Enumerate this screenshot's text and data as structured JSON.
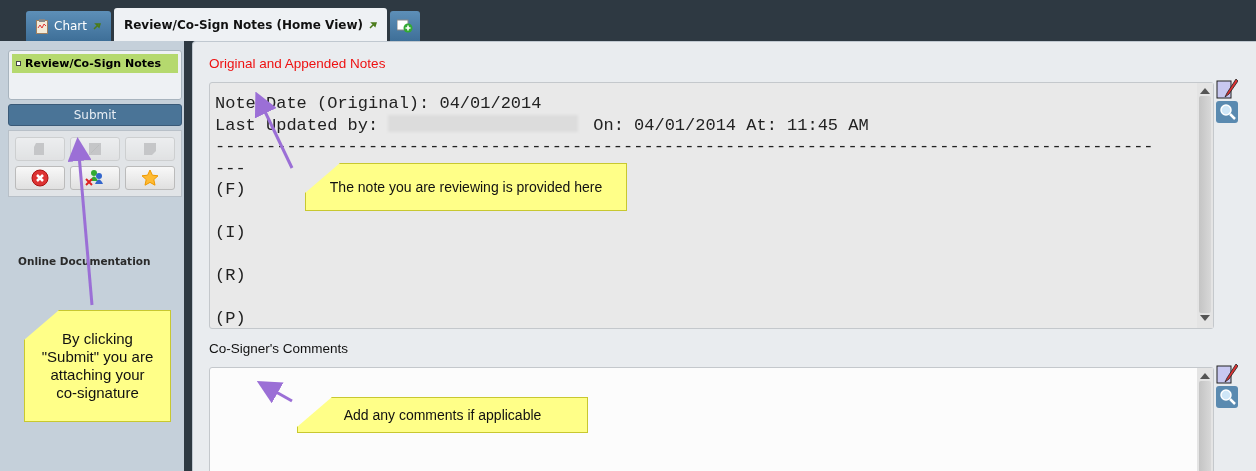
{
  "tabs": [
    {
      "label": "Chart",
      "kind": "chart",
      "selected": false
    },
    {
      "label": "Review/Co-Sign Notes (Home View)",
      "kind": "notes",
      "selected": true
    }
  ],
  "sidebar": {
    "items": [
      {
        "label": "Review/Co-Sign Notes",
        "selected": true
      }
    ],
    "submit_button": "Submit",
    "toolbar": [
      {
        "kind": "copy",
        "disabled": true
      },
      {
        "kind": "page",
        "disabled": true
      },
      {
        "kind": "note",
        "disabled": true
      },
      {
        "kind": "cancel",
        "disabled": false
      },
      {
        "kind": "people",
        "disabled": false
      },
      {
        "kind": "star",
        "disabled": false
      }
    ],
    "link": "Online Documentation"
  },
  "notes_section": {
    "title": "Original and Appended Notes",
    "lines": [
      "Note Date (Original): 04/01/2014"
    ],
    "updated_by_label": "Last Updated by:",
    "updated_on": "On: 04/01/2014 At: 11:45 AM",
    "separator": "--------------------------------------------------------------------------------------------",
    "separator_tail": "---",
    "sections": [
      "(F)",
      "(I)",
      "(R)",
      "(P)"
    ]
  },
  "comments_section": {
    "title": "Co-Signer's Comments"
  },
  "callouts": [
    {
      "text": "The note you are reviewing is provided here"
    },
    {
      "text": "By clicking \"Submit\" you are attaching your co-signature"
    },
    {
      "text": "Add any comments if applicable"
    }
  ]
}
